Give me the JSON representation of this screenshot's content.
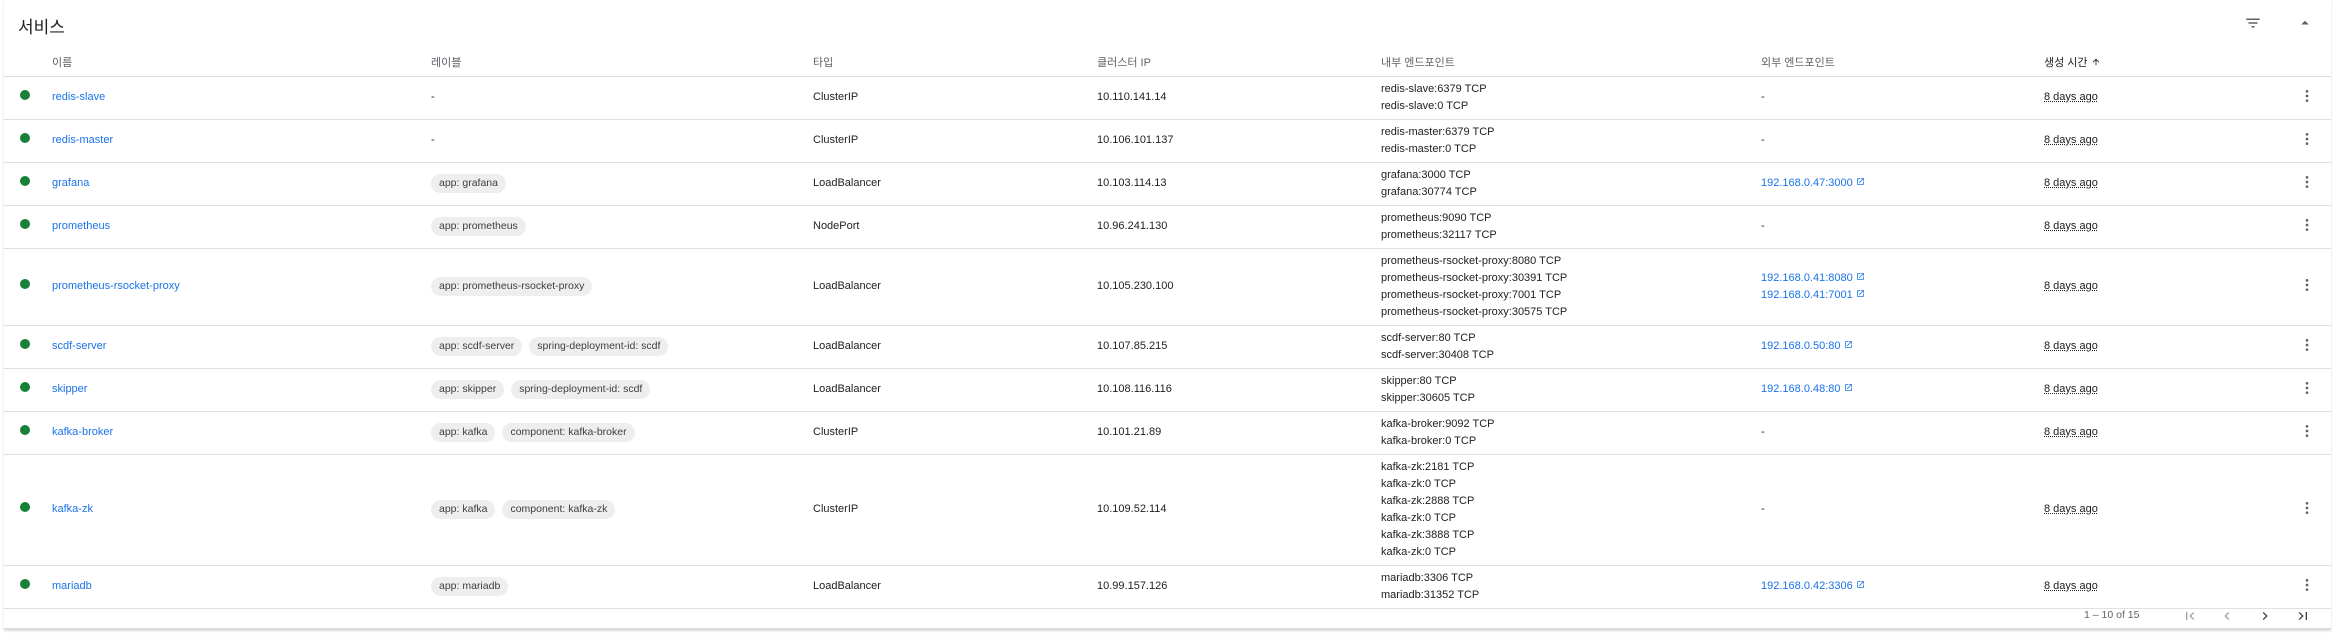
{
  "header": {
    "title": "서비스"
  },
  "columns": {
    "name": "이름",
    "labels": "레이블",
    "type": "타입",
    "cluster_ip": "클러스터 IP",
    "internal_endpoints": "내부 엔드포인트",
    "external_endpoints": "외부 엔드포인트",
    "created": "생성 시간"
  },
  "rows": [
    {
      "name": "redis-slave",
      "labels_text": "-",
      "labels": [],
      "type": "ClusterIP",
      "cluster_ip": "10.110.141.14",
      "internal": [
        "redis-slave:6379 TCP",
        "redis-slave:0 TCP"
      ],
      "external_text": "-",
      "external": [],
      "created": "8 days ago"
    },
    {
      "name": "redis-master",
      "labels_text": "-",
      "labels": [],
      "type": "ClusterIP",
      "cluster_ip": "10.106.101.137",
      "internal": [
        "redis-master:6379 TCP",
        "redis-master:0 TCP"
      ],
      "external_text": "-",
      "external": [],
      "created": "8 days ago"
    },
    {
      "name": "grafana",
      "labels_text": "",
      "labels": [
        "app: grafana"
      ],
      "type": "LoadBalancer",
      "cluster_ip": "10.103.114.13",
      "internal": [
        "grafana:3000 TCP",
        "grafana:30774 TCP"
      ],
      "external_text": "",
      "external": [
        "192.168.0.47:3000"
      ],
      "created": "8 days ago"
    },
    {
      "name": "prometheus",
      "labels_text": "",
      "labels": [
        "app: prometheus"
      ],
      "type": "NodePort",
      "cluster_ip": "10.96.241.130",
      "internal": [
        "prometheus:9090 TCP",
        "prometheus:32117 TCP"
      ],
      "external_text": "-",
      "external": [],
      "created": "8 days ago"
    },
    {
      "name": "prometheus-rsocket-proxy",
      "labels_text": "",
      "labels": [
        "app: prometheus-rsocket-proxy"
      ],
      "type": "LoadBalancer",
      "cluster_ip": "10.105.230.100",
      "internal": [
        "prometheus-rsocket-proxy:8080 TCP",
        "prometheus-rsocket-proxy:30391 TCP",
        "prometheus-rsocket-proxy:7001 TCP",
        "prometheus-rsocket-proxy:30575 TCP"
      ],
      "external_text": "",
      "external": [
        "192.168.0.41:8080",
        "192.168.0.41:7001"
      ],
      "created": "8 days ago"
    },
    {
      "name": "scdf-server",
      "labels_text": "",
      "labels": [
        "app: scdf-server",
        "spring-deployment-id: scdf"
      ],
      "type": "LoadBalancer",
      "cluster_ip": "10.107.85.215",
      "internal": [
        "scdf-server:80 TCP",
        "scdf-server:30408 TCP"
      ],
      "external_text": "",
      "external": [
        "192.168.0.50:80"
      ],
      "created": "8 days ago"
    },
    {
      "name": "skipper",
      "labels_text": "",
      "labels": [
        "app: skipper",
        "spring-deployment-id: scdf"
      ],
      "type": "LoadBalancer",
      "cluster_ip": "10.108.116.116",
      "internal": [
        "skipper:80 TCP",
        "skipper:30605 TCP"
      ],
      "external_text": "",
      "external": [
        "192.168.0.48:80"
      ],
      "created": "8 days ago"
    },
    {
      "name": "kafka-broker",
      "labels_text": "",
      "labels": [
        "app: kafka",
        "component: kafka-broker"
      ],
      "type": "ClusterIP",
      "cluster_ip": "10.101.21.89",
      "internal": [
        "kafka-broker:9092 TCP",
        "kafka-broker:0 TCP"
      ],
      "external_text": "-",
      "external": [],
      "created": "8 days ago"
    },
    {
      "name": "kafka-zk",
      "labels_text": "",
      "labels": [
        "app: kafka",
        "component: kafka-zk"
      ],
      "type": "ClusterIP",
      "cluster_ip": "10.109.52.114",
      "internal": [
        "kafka-zk:2181 TCP",
        "kafka-zk:0 TCP",
        "kafka-zk:2888 TCP",
        "kafka-zk:0 TCP",
        "kafka-zk:3888 TCP",
        "kafka-zk:0 TCP"
      ],
      "external_text": "-",
      "external": [],
      "created": "8 days ago"
    },
    {
      "name": "mariadb",
      "labels_text": "",
      "labels": [
        "app: mariadb"
      ],
      "type": "LoadBalancer",
      "cluster_ip": "10.99.157.126",
      "internal": [
        "mariadb:3306 TCP",
        "mariadb:31352 TCP"
      ],
      "external_text": "",
      "external": [
        "192.168.0.42:3306"
      ],
      "created": "8 days ago"
    }
  ],
  "pagination": {
    "range": "1 – 10 of 15"
  },
  "icons": {
    "filter": "filter-icon",
    "collapse": "chevron-up-icon",
    "sort": "arrow-upward-icon",
    "menu": "more-vert-icon",
    "open_in_new": "open-in-new-icon"
  },
  "colors": {
    "status_ok": "#188038",
    "link": "#1a73e8"
  }
}
